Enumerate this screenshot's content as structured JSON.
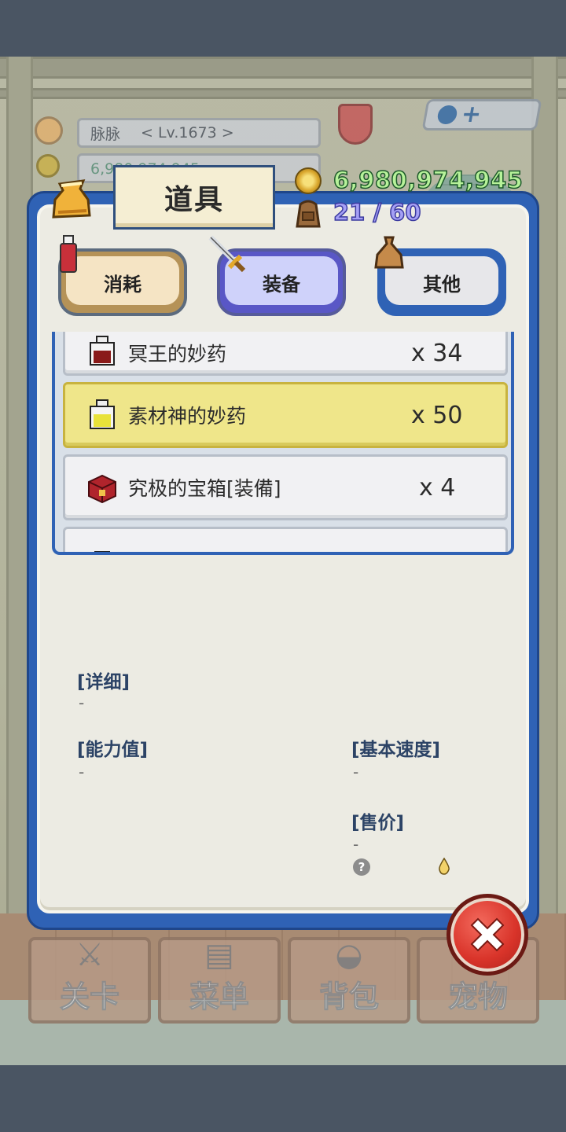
{
  "player": {
    "name": "脉脉",
    "level": "< Lv.1673 >",
    "gold_bg": "6,980,974,945"
  },
  "panel": {
    "title": "道具",
    "gold": "6,980,974,945",
    "capacity": "21 / 60"
  },
  "tabs": [
    {
      "label": "消耗",
      "icon": "potion-icon"
    },
    {
      "label": "装备",
      "icon": "sword-icon",
      "selected": true
    },
    {
      "label": "其他",
      "icon": "sack-icon"
    }
  ],
  "items": [
    {
      "name": "冥王的妙药",
      "qty": "x 34",
      "icon": "dark-potion-icon"
    },
    {
      "name": "素材神的妙药",
      "qty": "x 50",
      "icon": "yellow-potion-icon",
      "selected": true
    },
    {
      "name": "究极的宝箱[装備]",
      "qty": "x 4",
      "icon": "red-chest-icon"
    }
  ],
  "details": {
    "detail_label": "[详细]",
    "detail_value": "-",
    "stats_label": "[能力值]",
    "stats_value": "-",
    "speed_label": "[基本速度]",
    "speed_value": "-",
    "price_label": "[售价]",
    "price_value": "-",
    "price_icon_label": "?"
  },
  "nav": [
    {
      "label": "关卡",
      "icon": "crossed-swords-icon"
    },
    {
      "label": "菜单",
      "icon": "book-icon"
    },
    {
      "label": "背包",
      "icon": "backpack-icon"
    },
    {
      "label": "宠物",
      "icon": "pet-icon"
    }
  ],
  "colors": {
    "panel_blue": "#2f62b5",
    "selected_row": "#efe68a",
    "gold_text": "#b7f29a",
    "capacity_text": "#a5a0f5",
    "close_red": "#d9342a"
  }
}
